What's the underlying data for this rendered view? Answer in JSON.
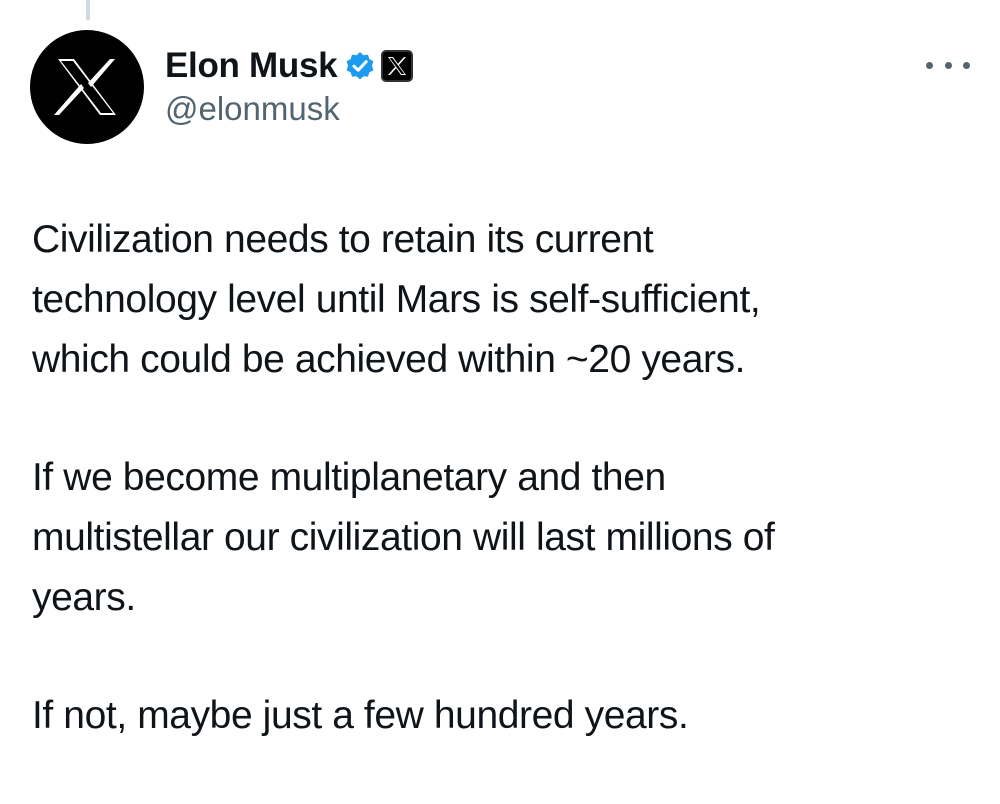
{
  "tweet": {
    "author": {
      "display_name": "Elon Musk",
      "handle": "@elonmusk",
      "avatar_icon": "x-logo-icon",
      "verified_icon": "verified-badge-icon",
      "affiliate_icon": "x-affiliate-badge-icon",
      "verified_color": "#1d9bf0"
    },
    "menu_icon": "more-options-icon",
    "paragraphs": [
      "Civilization needs to retain its current\ntechnology level until Mars is self-sufficient,\nwhich could be achieved within ~20 years.",
      "If we become multiplanetary and then\nmultistellar our civilization will last millions of\nyears.",
      "If not, maybe just a few hundred years."
    ]
  }
}
